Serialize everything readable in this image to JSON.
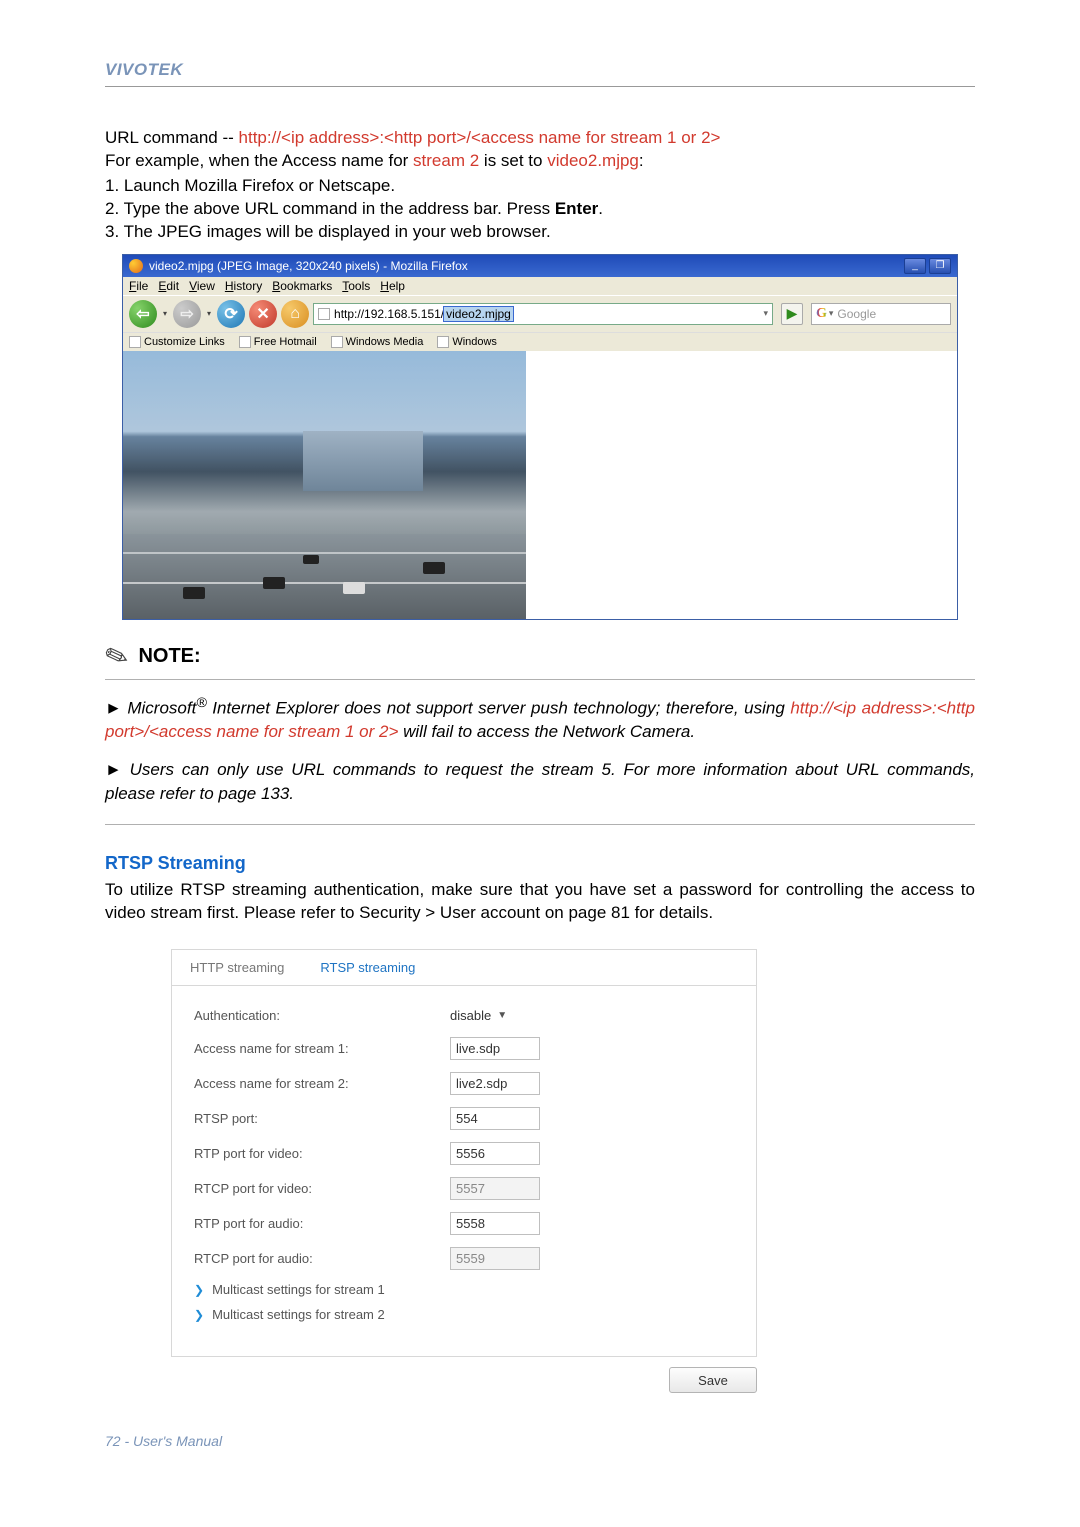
{
  "brand": "VIVOTEK",
  "intro": {
    "url_cmd_prefix": "URL command -- ",
    "url_cmd_link": "http://<ip address>:<http port>/<access name for stream 1 or 2>",
    "for_example_pre": "For example, when the Access name for ",
    "for_example_stream": "stream 2",
    "for_example_mid": " is set to ",
    "for_example_val": "video2.mjpg",
    "for_example_post": ":",
    "step1": "1. Launch Mozilla Firefox or Netscape.",
    "step2_pre": "2. Type the above URL command in the address bar. Press ",
    "step2_bold": "Enter",
    "step2_post": ".",
    "step3": "3. The JPEG images will be displayed in your web browser."
  },
  "firefox": {
    "title": "video2.mjpg (JPEG Image, 320x240 pixels) - Mozilla Firefox",
    "menus": [
      "File",
      "Edit",
      "View",
      "History",
      "Bookmarks",
      "Tools",
      "Help"
    ],
    "url_base": "http://192.168.5.151/",
    "url_selected": "video2.mjpg",
    "search_placeholder": "Google",
    "bookmarks": [
      "Customize Links",
      "Free Hotmail",
      "Windows Media",
      "Windows"
    ]
  },
  "note": {
    "label": "NOTE:",
    "p1_pre": "► Microsoft",
    "p1_sup": "®",
    "p1_mid": " Internet Explorer does not support server push technology; therefore, using ",
    "p1_link": "http://<ip address>:<http port>/<access name for stream 1 or 2>",
    "p1_post": " will fail to access the Network Camera.",
    "p2": "► Users can only use URL commands to request the stream 5. For more information about URL commands, please refer to page 133."
  },
  "rtsp": {
    "title": "RTSP Streaming",
    "intro": "To utilize RTSP streaming authentication, make sure that you have set a password for controlling the access to video stream first. Please refer to Security > User account on page 81 for details.",
    "tabs": {
      "http": "HTTP streaming",
      "rtsp": "RTSP streaming"
    },
    "fields": {
      "auth_label": "Authentication:",
      "auth_value": "disable",
      "an1_label": "Access name for stream 1:",
      "an1_value": "live.sdp",
      "an2_label": "Access name for stream 2:",
      "an2_value": "live2.sdp",
      "rtsp_port_label": "RTSP port:",
      "rtsp_port_value": "554",
      "rtp_vid_label": "RTP port for video:",
      "rtp_vid_value": "5556",
      "rtcp_vid_label": "RTCP port for video:",
      "rtcp_vid_value": "5557",
      "rtp_aud_label": "RTP port for audio:",
      "rtp_aud_value": "5558",
      "rtcp_aud_label": "RTCP port for audio:",
      "rtcp_aud_value": "5559",
      "mcast1": "Multicast settings for stream 1",
      "mcast2": "Multicast settings for stream 2"
    },
    "save": "Save"
  },
  "footer": "72 - User's Manual"
}
